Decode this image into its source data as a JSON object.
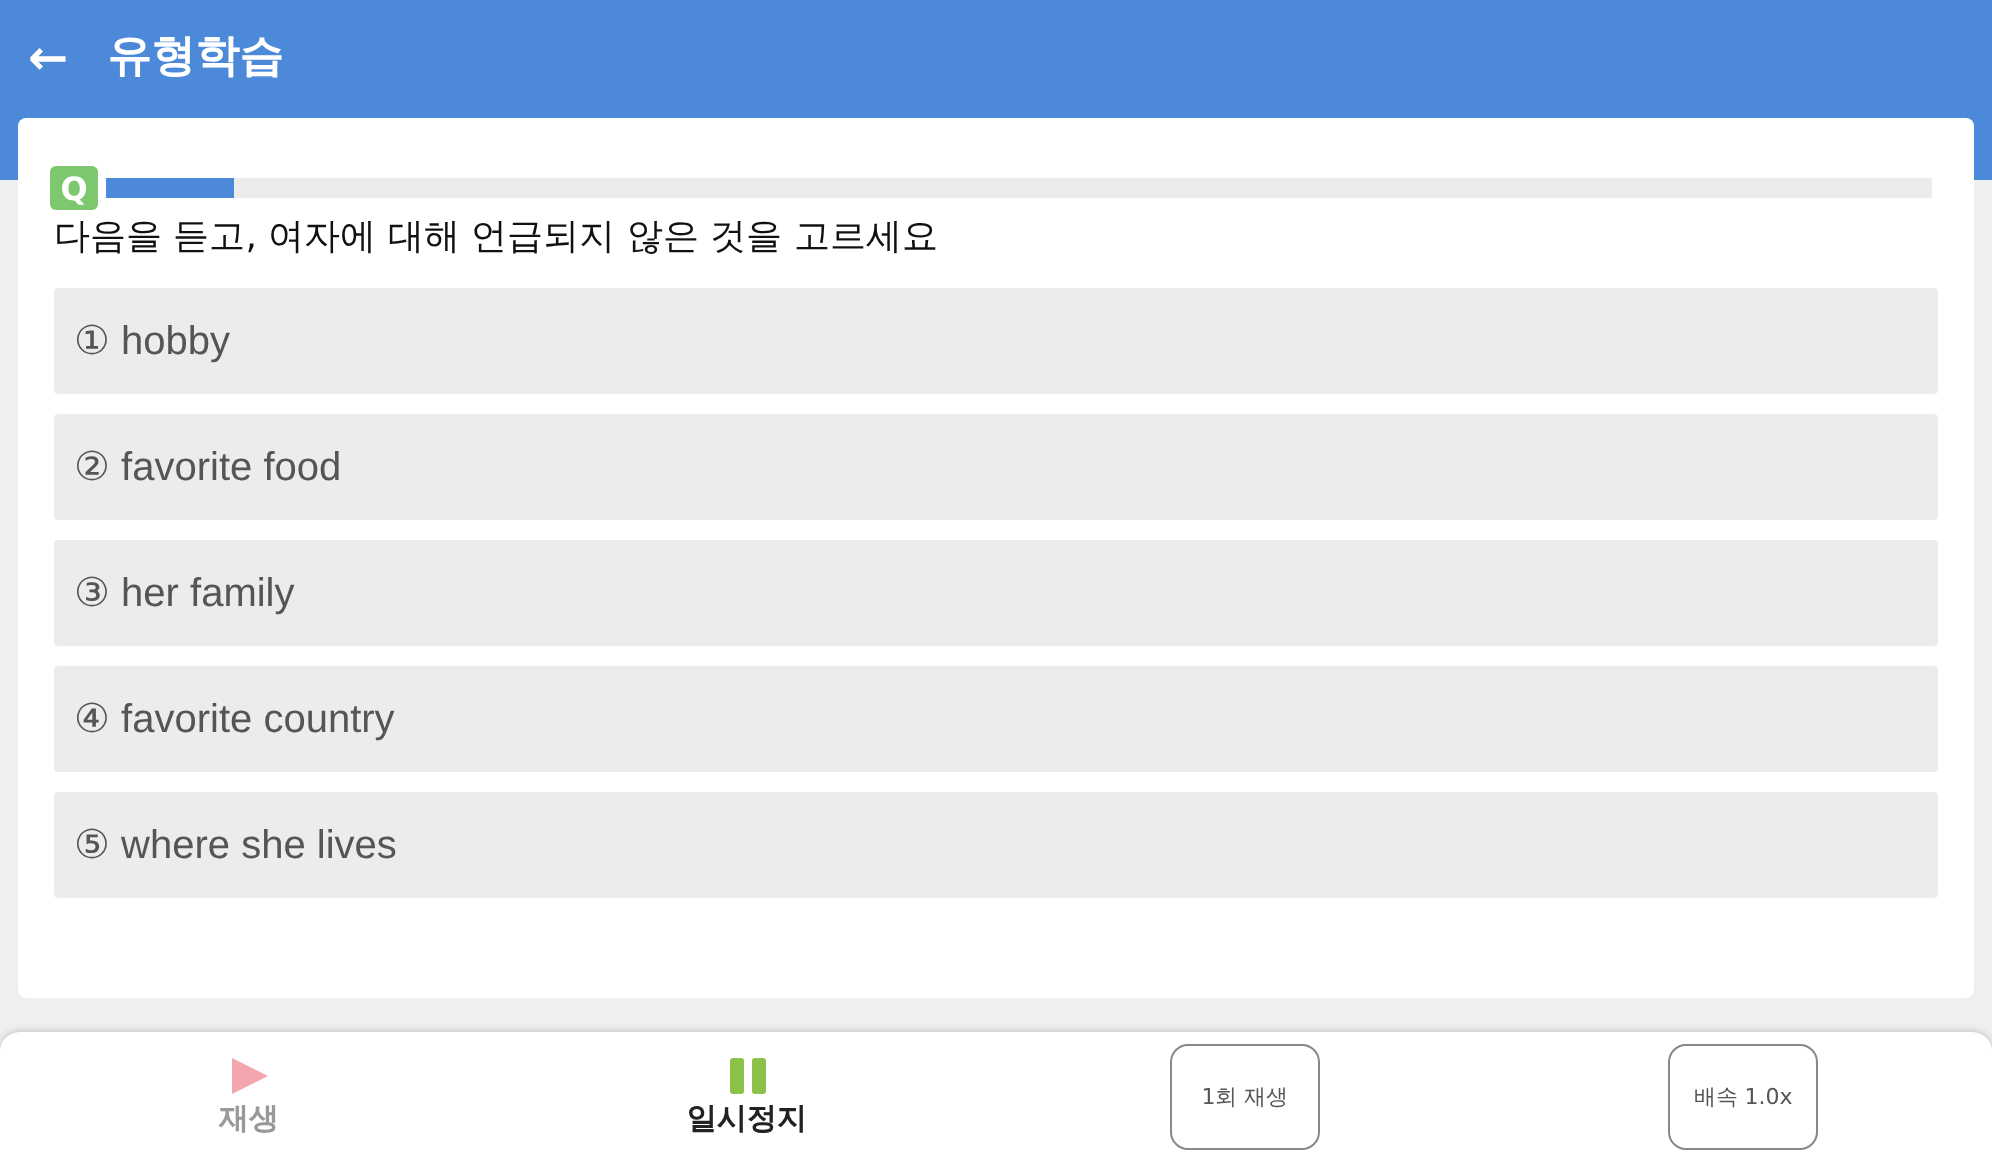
{
  "header": {
    "back_icon": "←",
    "title": "유형학습"
  },
  "question": {
    "badge": "Q",
    "progress": {
      "level": 0.07
    },
    "prompt": "다음을 듣고, 여자에 대해 언급되지 않은 것을 고르세요",
    "options": [
      {
        "label": "① hobby",
        "selected": false
      },
      {
        "label": "② favorite food",
        "selected": false
      },
      {
        "label": "③ her family",
        "selected": false
      },
      {
        "label": "④ favorite country",
        "selected": false
      },
      {
        "label": "⑤ where she lives",
        "selected": false
      }
    ]
  },
  "controls": [
    {
      "kind": "play",
      "label": "재생",
      "active": false
    },
    {
      "kind": "pause",
      "label": "일시정지",
      "active": true
    },
    {
      "kind": "button",
      "label": "1회 재생"
    },
    {
      "kind": "button",
      "label": "배속 1.0x"
    }
  ]
}
